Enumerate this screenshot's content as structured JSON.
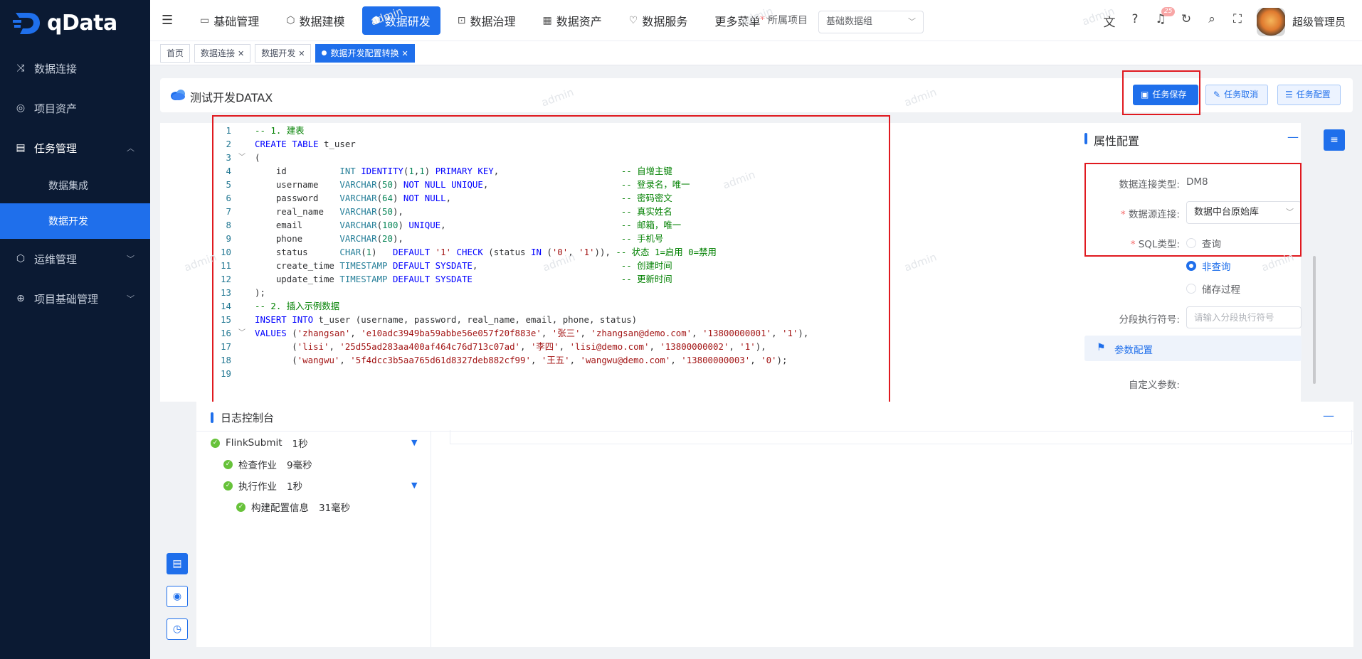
{
  "app": {
    "brand": "qData",
    "brand_color": "#1f6feb"
  },
  "sidebar": {
    "items": [
      {
        "label": "数据连接",
        "icon": "shuffle-icon"
      },
      {
        "label": "项目资产",
        "icon": "coin-icon"
      },
      {
        "label": "任务管理",
        "icon": "doc-list-icon",
        "expanded": true,
        "children": [
          {
            "label": "数据集成"
          },
          {
            "label": "数据开发",
            "active": true
          }
        ]
      },
      {
        "label": "运维管理",
        "icon": "cube-icon"
      },
      {
        "label": "项目基础管理",
        "icon": "globe-icon"
      }
    ]
  },
  "topnav": {
    "items": [
      {
        "label": "基础管理",
        "icon": "doc-icon"
      },
      {
        "label": "数据建模",
        "icon": "cube-icon"
      },
      {
        "label": "数据研发",
        "icon": "gear-hex-icon",
        "active": true
      },
      {
        "label": "数据治理",
        "icon": "scan-icon"
      },
      {
        "label": "数据资产",
        "icon": "report-icon"
      },
      {
        "label": "数据服务",
        "icon": "heart-icon"
      },
      {
        "label": "更多菜单",
        "icon": "chevron-down-icon"
      }
    ],
    "project_label": "所属项目",
    "project_value": "基础数据组",
    "notifications": "25",
    "username": "超级管理员"
  },
  "tabs": [
    {
      "label": "首页"
    },
    {
      "label": "数据连接",
      "closable": true
    },
    {
      "label": "数据开发",
      "closable": true
    },
    {
      "label": "数据开发配置转换",
      "closable": true,
      "active": true
    }
  ],
  "task": {
    "title": "测试开发DATAX",
    "save_label": "任务保存",
    "cancel_label": "任务取消",
    "config_label": "任务配置"
  },
  "editor": {
    "lines": [
      "-- 1. 建表",
      "CREATE TABLE t_user",
      "(",
      "    id          INT IDENTITY(1,1) PRIMARY KEY,                       -- 自增主键",
      "    username    VARCHAR(50) NOT NULL UNIQUE,                         -- 登录名，唯一",
      "    password    VARCHAR(64) NOT NULL,                                -- 密码密文",
      "    real_name   VARCHAR(50),                                         -- 真实姓名",
      "    email       VARCHAR(100) UNIQUE,                                 -- 邮箱，唯一",
      "    phone       VARCHAR(20),                                         -- 手机号",
      "    status      CHAR(1)   DEFAULT '1' CHECK (status IN ('0', '1')), -- 状态 1=启用 0=禁用",
      "    create_time TIMESTAMP DEFAULT SYSDATE,                           -- 创建时间",
      "    update_time TIMESTAMP DEFAULT SYSDATE                            -- 更新时间",
      ");",
      "-- 2. 插入示例数据",
      "INSERT INTO t_user (username, password, real_name, email, phone, status)",
      "VALUES ('zhangsan', 'e10adc3949ba59abbe56e057f20f883e', '张三', 'zhangsan@demo.com', '13800000001', '1'),",
      "       ('lisi', '25d55ad283aa400af464c76d713c07ad', '李四', 'lisi@demo.com', '13800000002', '1'),",
      "       ('wangwu', '5f4dcc3b5aa765d61d8327deb882cf99', '王五', 'wangwu@demo.com', '13800000003', '0');",
      ""
    ]
  },
  "properties": {
    "title": "属性配置",
    "conn_type_label": "数据连接类型:",
    "conn_type_value": "DM8",
    "datasource_label": "数据源连接:",
    "datasource_value": "数据中台原始库",
    "sql_type_label": "SQL类型:",
    "sql_types": [
      {
        "label": "查询",
        "checked": false
      },
      {
        "label": "非查询",
        "checked": true
      },
      {
        "label": "储存过程",
        "checked": false
      }
    ],
    "segment_label": "分段执行符号:",
    "segment_placeholder": "请输入分段执行符号",
    "param_section": "参数配置",
    "custom_param_label": "自定义参数:"
  },
  "log": {
    "title": "日志控制台",
    "nodes": [
      {
        "name": "FlinkSubmit",
        "duration": "1秒",
        "level": 0,
        "expandable": true
      },
      {
        "name": "检查作业",
        "duration": "9毫秒",
        "level": 1
      },
      {
        "name": "执行作业",
        "duration": "1秒",
        "level": 1,
        "expandable": true
      },
      {
        "name": "构建配置信息",
        "duration": "31毫秒",
        "level": 2
      }
    ]
  },
  "watermark": "admin"
}
